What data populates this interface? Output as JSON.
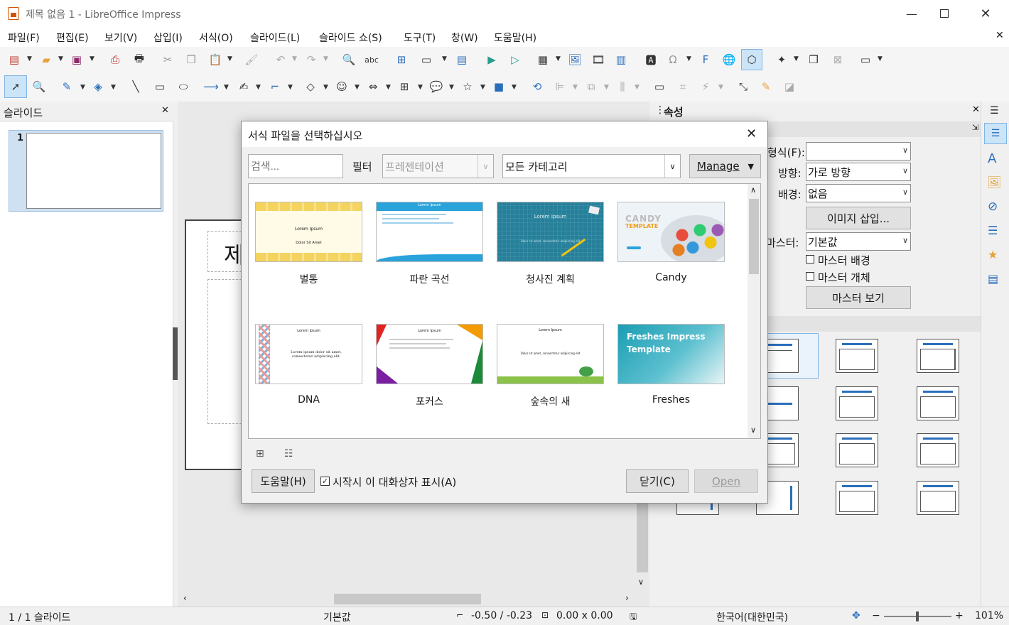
{
  "window": {
    "title": "제목 없음 1 - LibreOffice Impress"
  },
  "menu": [
    "파일(F)",
    "편집(E)",
    "보기(V)",
    "삽입(I)",
    "서식(O)",
    "슬라이드(L)",
    "슬라이드 쇼(S)",
    "도구(T)",
    "창(W)",
    "도움말(H)"
  ],
  "slides_panel": {
    "title": "슬라이드",
    "slide_number": "1"
  },
  "slide_title_partial": "제",
  "properties_panel": {
    "title": "속성",
    "format_label": "형식(F):",
    "format_value": "",
    "orientation_label": "방향:",
    "orientation_value": "가로 방향",
    "background_label": "배경:",
    "background_value": "없음",
    "insert_image": "이미지 삽입...",
    "master_label": "마스터:",
    "master_value": "기본값",
    "master_background": "마스터 배경",
    "master_objects": "마스터 개체",
    "master_view": "마스터 보기"
  },
  "dialog": {
    "title": "서식 파일을 선택하십시오",
    "search_placeholder": "검색...",
    "filter_label": "필터",
    "filter_value": "프레젠테이션",
    "category_value": "모든 카테고리",
    "manage": "Manage",
    "templates": [
      {
        "name": "벌통",
        "thumb_text": "Lorem Ipsum",
        "thumb_sub": "Dolor Sit Amet"
      },
      {
        "name": "파란 곡선",
        "thumb_text": "Lorem Ipsum",
        "thumb_sub": ""
      },
      {
        "name": "청사진 계획",
        "thumb_text": "Lorem Ipsum",
        "thumb_sub": "Dolor sit amet, consectetur adipiscing elit"
      },
      {
        "name": "Candy",
        "thumb_text": "CANDY",
        "thumb_sub": "TEMPLATE"
      },
      {
        "name": "DNA",
        "thumb_text": "Lorem Ipsum",
        "thumb_sub": "Lorem ipsum dolor sit amet, consectetur adipiscing elit."
      },
      {
        "name": "포커스",
        "thumb_text": "Lorem Ipsum",
        "thumb_sub": ""
      },
      {
        "name": "숲속의 새",
        "thumb_text": "Lorem Ipsum",
        "thumb_sub": "Dolor sit amet, consectetur adipiscing elit"
      },
      {
        "name": "Freshes",
        "thumb_text": "Freshes Impress Template",
        "thumb_sub": ""
      }
    ],
    "help": "도움말(H)",
    "show_on_startup": "시작시 이 대화상자 표시(A)",
    "show_on_startup_checked": true,
    "close": "닫기(C)",
    "open": "Open"
  },
  "statusbar": {
    "slide": "1 / 1 슬라이드",
    "master": "기본값",
    "position": "-0.50 / -0.23",
    "size": "0.00 x 0.00",
    "language": "한국어(대한민국)",
    "zoom": "101%"
  },
  "colors": {
    "accent": "#2a6ebb",
    "selection": "#cce4f7"
  }
}
